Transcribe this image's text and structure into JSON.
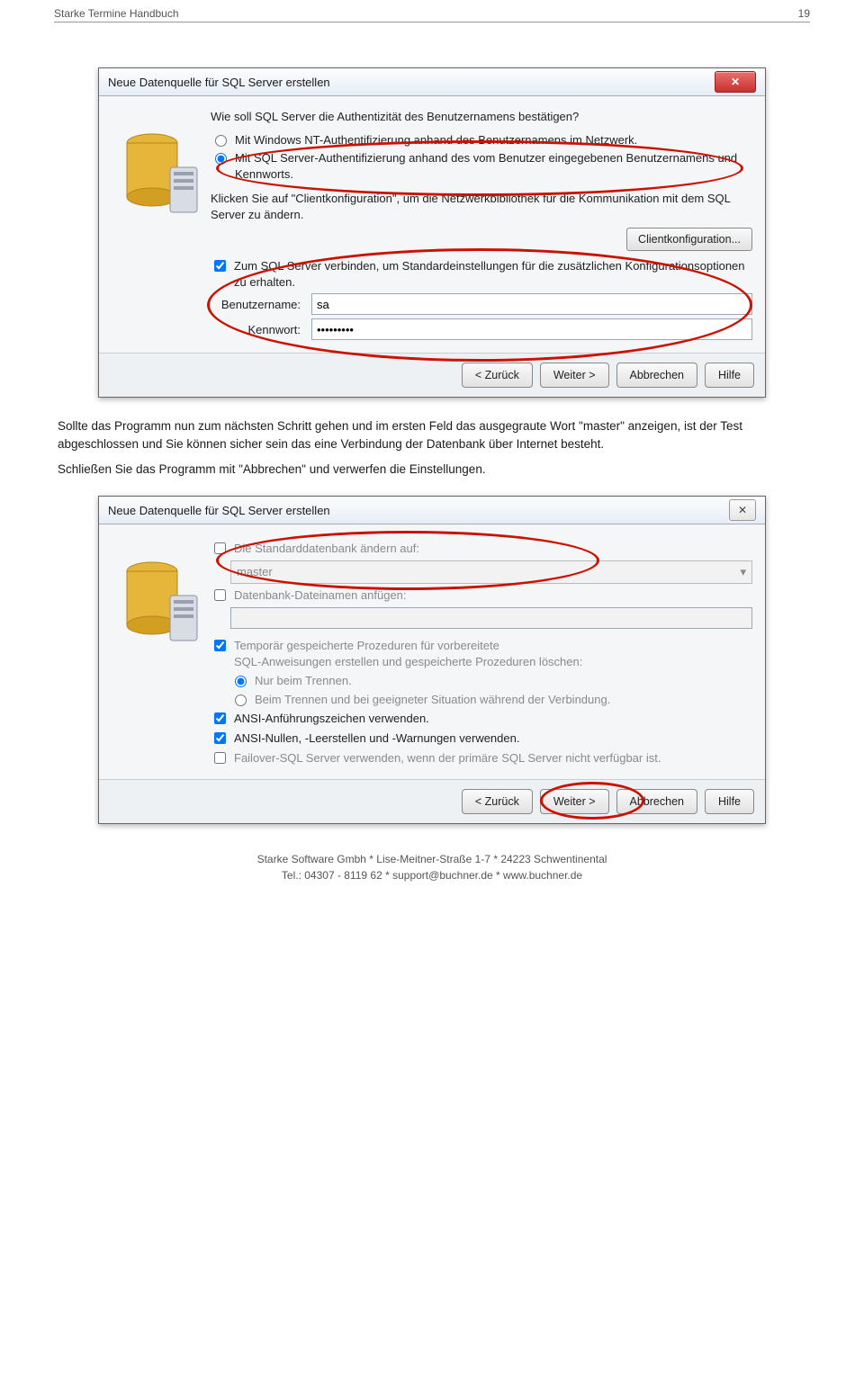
{
  "header": {
    "title": "Starke Termine Handbuch",
    "page": "19"
  },
  "dlg1": {
    "title": "Neue Datenquelle für SQL Server erstellen",
    "q": "Wie soll SQL Server die Authentizität des Benutzernamens bestätigen?",
    "opt1": "Mit Windows NT-Authentifizierung anhand des Benutzernamens im Netzwerk.",
    "opt2": "Mit SQL Server-Authentifizierung anhand des vom Benutzer eingegebenen Benutzernamens und Kennworts.",
    "cfgtxt": "Klicken Sie auf \"Clientkonfiguration\", um die Netzwerkbibliothek für die Kommunikation mit dem SQL Server zu ändern.",
    "cfgbtn": "Clientkonfiguration...",
    "chk": "Zum SQL Server verbinden, um Standardeinstellungen für die zusätzlichen Konfigurationsoptionen zu erhalten.",
    "user_l": "Benutzername:",
    "user_v": "sa",
    "pass_l": "Kennwort:",
    "pass_v": "•••••••••",
    "b_back": "< Zurück",
    "b_next": "Weiter >",
    "b_cancel": "Abbrechen",
    "b_help": "Hilfe"
  },
  "para1": "Sollte das Programm nun zum nächsten Schritt gehen und im ersten Feld das ausgegraute Wort \"master\" anzeigen, ist der Test abgeschlossen und Sie können sicher sein das eine Verbindung der Datenbank über Internet besteht.",
  "para2": "Schließen Sie das Programm mit \"Abbrechen\" und verwerfen die Einstellungen.",
  "dlg2": {
    "title": "Neue Datenquelle für SQL Server erstellen",
    "c1": "Die Standarddatenbank ändern auf:",
    "db": "master",
    "c2": "Datenbank-Dateinamen anfügen:",
    "c3a": "Temporär gespeicherte Prozeduren für vorbereitete",
    "c3b": "SQL-Anweisungen erstellen und gespeicherte Prozeduren löschen:",
    "r1": "Nur beim Trennen.",
    "r2": "Beim Trennen und bei geeigneter Situation während der Verbindung.",
    "c4": "ANSI-Anführungszeichen verwenden.",
    "c5": "ANSI-Nullen, -Leerstellen und -Warnungen verwenden.",
    "c6": "Failover-SQL Server verwenden, wenn der primäre SQL Server nicht verfügbar ist.",
    "b_back": "< Zurück",
    "b_next": "Weiter >",
    "b_cancel": "Abbrechen",
    "b_help": "Hilfe"
  },
  "footer": {
    "l1": "Starke Software Gmbh * Lise-Meitner-Straße 1-7 * 24223 Schwentinental",
    "l2": "Tel.: 04307 - 8119 62 * support@buchner.de * www.buchner.de"
  }
}
